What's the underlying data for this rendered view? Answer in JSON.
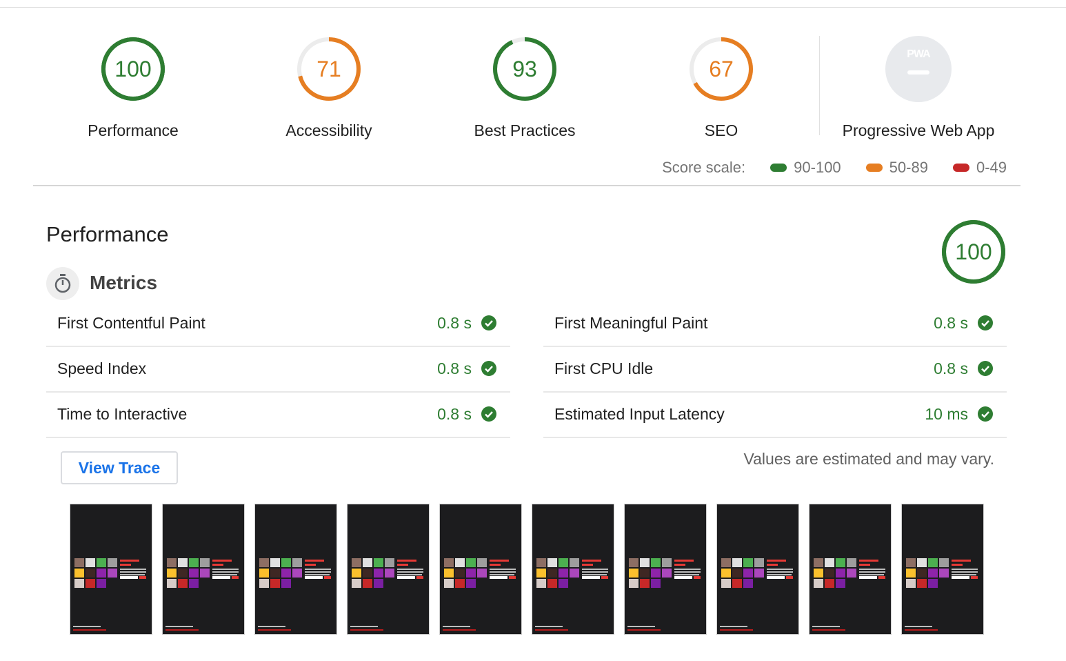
{
  "colors": {
    "pass": "#2e7d32",
    "average": "#e67e22",
    "fail": "#c62828",
    "link": "#1a73e8",
    "na": "#e8eaed"
  },
  "categories": [
    {
      "label": "Performance",
      "score": 100,
      "rating": "pass"
    },
    {
      "label": "Accessibility",
      "score": 71,
      "rating": "average"
    },
    {
      "label": "Best Practices",
      "score": 93,
      "rating": "pass"
    },
    {
      "label": "SEO",
      "score": 67,
      "rating": "average"
    }
  ],
  "pwa": {
    "label": "Progressive Web App",
    "badge": "PWA"
  },
  "score_scale": {
    "label": "Score scale:",
    "ranges": [
      {
        "label": "90-100",
        "color": "#2e7d32"
      },
      {
        "label": "50-89",
        "color": "#e67e22"
      },
      {
        "label": "0-49",
        "color": "#c62828"
      }
    ]
  },
  "performance": {
    "title": "Performance",
    "score": 100,
    "metrics_title": "Metrics",
    "metrics_left": [
      {
        "name": "First Contentful Paint",
        "value": "0.8 s"
      },
      {
        "name": "Speed Index",
        "value": "0.8 s"
      },
      {
        "name": "Time to Interactive",
        "value": "0.8 s"
      }
    ],
    "metrics_right": [
      {
        "name": "First Meaningful Paint",
        "value": "0.8 s"
      },
      {
        "name": "First CPU Idle",
        "value": "0.8 s"
      },
      {
        "name": "Estimated Input Latency",
        "value": "10 ms"
      }
    ],
    "view_trace_label": "View Trace",
    "note": "Values are estimated and may vary.",
    "filmstrip_frames": 10
  }
}
